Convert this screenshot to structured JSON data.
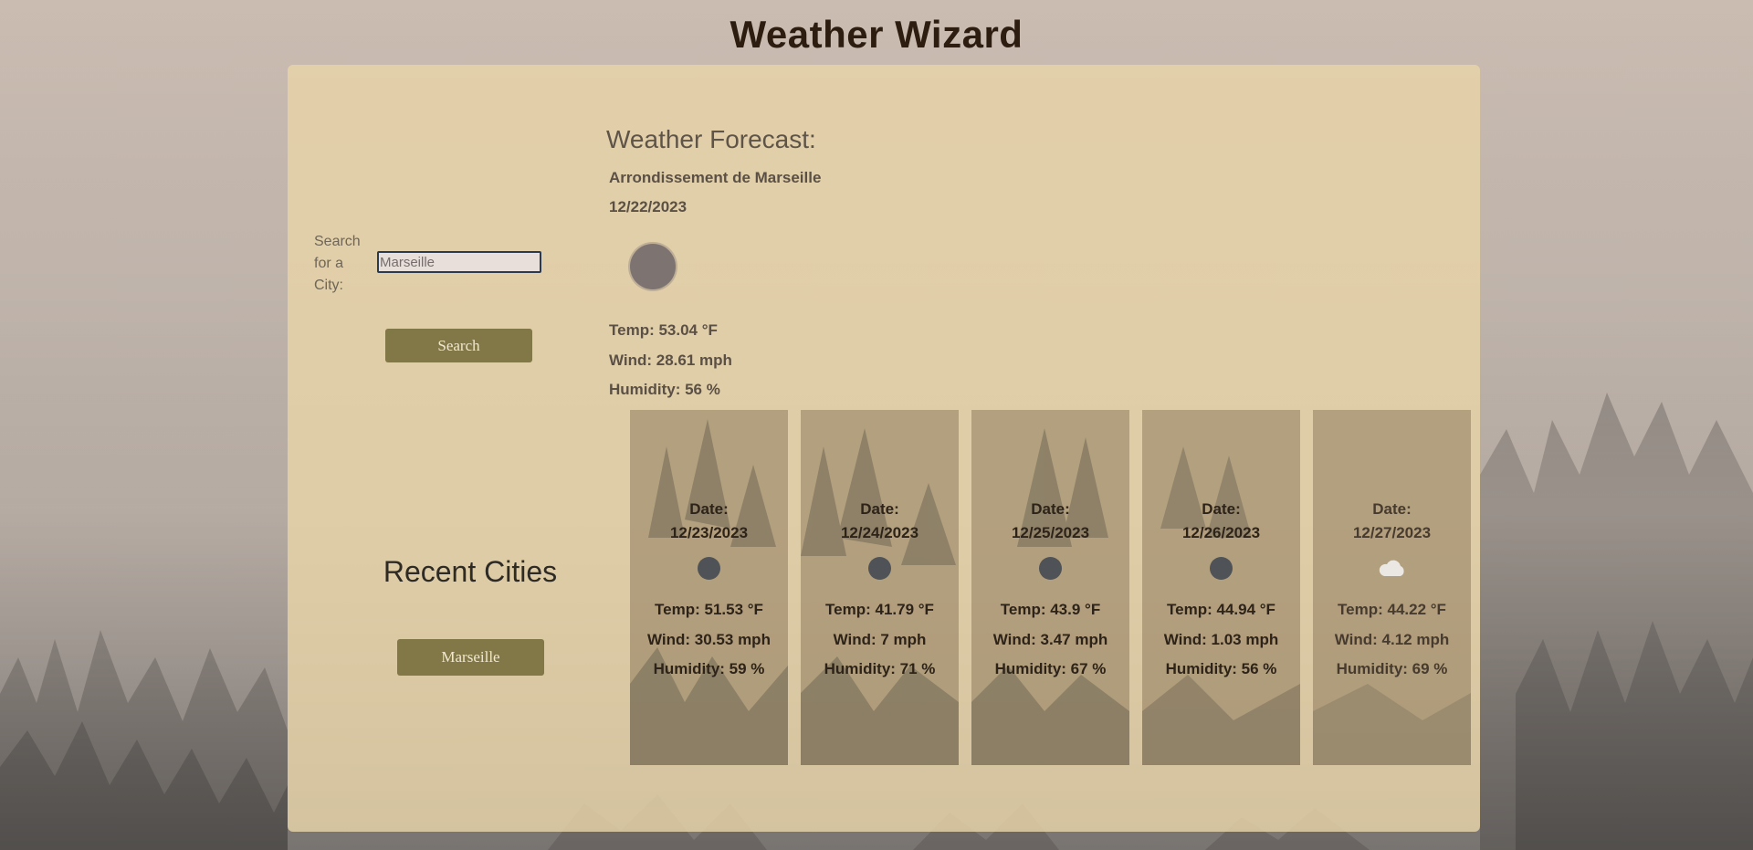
{
  "app": {
    "title": "Weather Wizard"
  },
  "search": {
    "label": "Search for a City:",
    "value": "Marseille",
    "button_label": "Search"
  },
  "recent": {
    "title": "Recent Cities",
    "cities": [
      "Marseille"
    ]
  },
  "current": {
    "heading": "Weather Forecast:",
    "city": "Arrondissement de Marseille",
    "date": "12/22/2023",
    "icon": "moon-icon",
    "temp": "Temp: 53.04 °F",
    "wind": "Wind: 28.61 mph",
    "humidity": "Humidity: 56 %"
  },
  "forecast": [
    {
      "label": "Date:",
      "date": "12/23/2023",
      "icon": "moon-icon",
      "temp": "Temp: 51.53 °F",
      "wind": "Wind: 30.53 mph",
      "humidity": "Humidity: 59 %"
    },
    {
      "label": "Date:",
      "date": "12/24/2023",
      "icon": "moon-icon",
      "temp": "Temp: 41.79 °F",
      "wind": "Wind: 7 mph",
      "humidity": "Humidity: 71 %"
    },
    {
      "label": "Date:",
      "date": "12/25/2023",
      "icon": "moon-icon",
      "temp": "Temp: 43.9 °F",
      "wind": "Wind: 3.47 mph",
      "humidity": "Humidity: 67 %"
    },
    {
      "label": "Date:",
      "date": "12/26/2023",
      "icon": "moon-icon",
      "temp": "Temp: 44.94 °F",
      "wind": "Wind: 1.03 mph",
      "humidity": "Humidity: 56 %"
    },
    {
      "label": "Date:",
      "date": "12/27/2023",
      "icon": "cloud-icon",
      "temp": "Temp: 44.22 °F",
      "wind": "Wind: 4.12 mph",
      "humidity": "Humidity: 69 %"
    }
  ],
  "colors": {
    "title_text": "#2c1d10",
    "panel": "#e8d4a8",
    "button": "#827746",
    "button_text": "#f0e8d1"
  }
}
